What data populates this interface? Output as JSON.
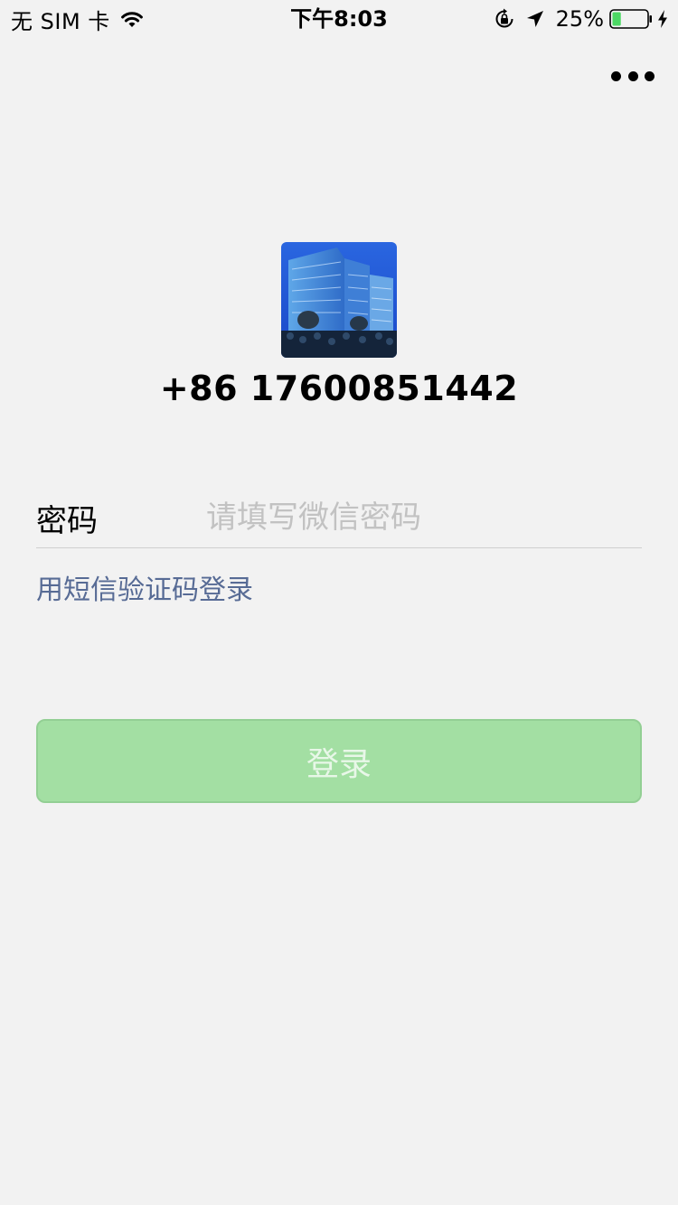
{
  "status_bar": {
    "carrier": "无 SIM 卡",
    "wifi_icon": "wifi-icon",
    "time": "下午8:03",
    "orientation_lock_icon": "orientation-lock-icon",
    "location_icon": "location-arrow-icon",
    "battery_percent": "25%",
    "battery_level": 0.25,
    "battery_icon": "battery-icon",
    "charging_icon": "charging-bolt-icon"
  },
  "header": {
    "more_icon": "more-dots-icon"
  },
  "profile": {
    "avatar": "avatar-building-photo",
    "phone": "+86 17600851442"
  },
  "form": {
    "password_label": "密码",
    "password_placeholder": "请填写微信密码",
    "password_value": "",
    "sms_login_link": "用短信验证码登录"
  },
  "actions": {
    "login_label": "登录"
  },
  "colors": {
    "background": "#f2f2f2",
    "link": "#576b95",
    "login_button_bg": "#a3dfa3",
    "login_button_text": "#e8f7e8",
    "battery_fill": "#4cd964"
  }
}
